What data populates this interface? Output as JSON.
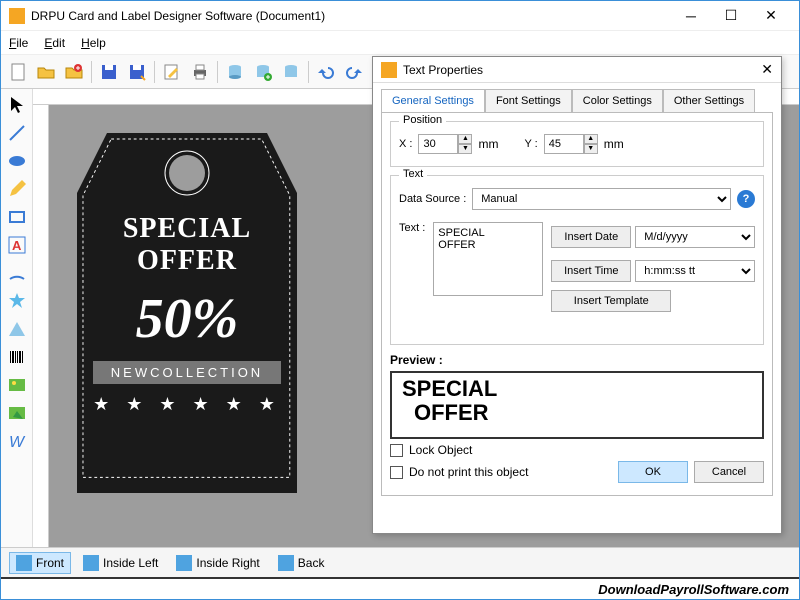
{
  "window": {
    "title": "DRPU Card and Label Designer Software (Document1)"
  },
  "menubar": {
    "file": "File",
    "edit": "Edit",
    "help": "Help"
  },
  "tag": {
    "line1a": "SPECIAL",
    "line1b": "OFFER",
    "percent": "50%",
    "band": "NEWCOLLECTION",
    "stars": "★ ★ ★ ★ ★ ★"
  },
  "pagetabs": {
    "front": "Front",
    "ileft": "Inside Left",
    "iright": "Inside Right",
    "back": "Back"
  },
  "footer": "DownloadPayrollSoftware.com",
  "dialog": {
    "title": "Text Properties",
    "tabs": {
      "general": "General Settings",
      "font": "Font Settings",
      "color": "Color Settings",
      "other": "Other Settings"
    },
    "position": {
      "legend": "Position",
      "xlabel": "X :",
      "xval": "30",
      "ylabel": "Y :",
      "yval": "45",
      "unit": "mm"
    },
    "text": {
      "legend": "Text",
      "ds_label": "Data Source :",
      "ds_value": "Manual",
      "text_label": "Text :",
      "text_value": "SPECIAL\nOFFER",
      "insert_date": "Insert Date",
      "date_fmt": "M/d/yyyy",
      "insert_time": "Insert Time",
      "time_fmt": "h:mm:ss tt",
      "insert_tpl": "Insert Template"
    },
    "preview_label": "Preview :",
    "preview_l1": "SPECIAL",
    "preview_l2": "OFFER",
    "lock": "Lock Object",
    "noprint": "Do not print this object",
    "ok": "OK",
    "cancel": "Cancel"
  }
}
